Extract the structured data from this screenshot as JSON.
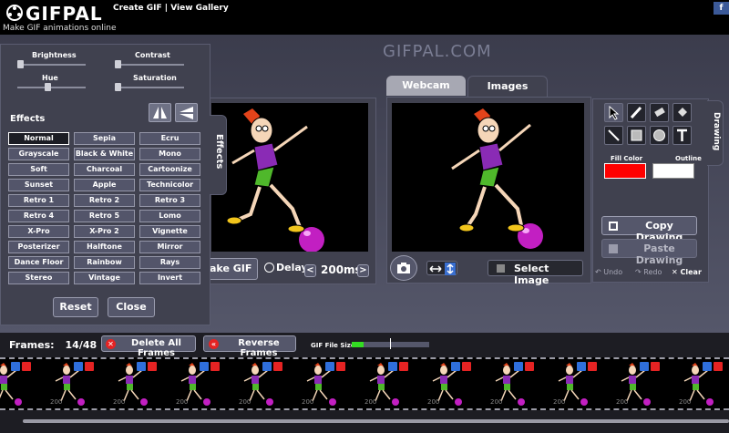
{
  "header": {
    "logo_text": "GIFPAL",
    "tagline": "Make GIF animations online",
    "nav": "Create GIF | View Gallery",
    "fb": "f"
  },
  "watermark": "GIFPAL.COM",
  "effects_panel": {
    "sliders": [
      {
        "label": "Brightness",
        "value": 0.0
      },
      {
        "label": "Contrast",
        "value": 0.0
      },
      {
        "label": "Hue",
        "value": 0.0
      },
      {
        "label": "Saturation",
        "value": 0.0
      }
    ],
    "title": "Effects",
    "tab_label": "Effects",
    "selected": "Normal",
    "effects": [
      "Normal",
      "Sepia",
      "Ecru",
      "Grayscale",
      "Black & White",
      "Mono",
      "Soft",
      "Charcoal",
      "Cartoonize",
      "Sunset",
      "Apple",
      "Technicolor",
      "Retro 1",
      "Retro 2",
      "Retro 3",
      "Retro 4",
      "Retro 5",
      "Lomo",
      "X-Pro",
      "X-Pro 2",
      "Vignette",
      "Posterizer",
      "Halftone",
      "Mirror",
      "Dance Floor",
      "Rainbow",
      "Rays",
      "Stereo",
      "Vintage",
      "Invert"
    ],
    "reset_label": "Reset",
    "close_label": "Close"
  },
  "left_frame": {
    "make_label": "ake GIF",
    "delay_label": "Delay:",
    "delay_value": "200ms",
    "prev": "<",
    "next": ">"
  },
  "right_frame": {
    "tabs": [
      "Webcam",
      "Images"
    ],
    "active_tab": "Images",
    "select_image_label": "Select Image"
  },
  "drawing": {
    "tab_label": "Drawing",
    "fill_label": "Fill Color",
    "outline_label": "Outline",
    "fill_color": "#ff0000",
    "outline_color": "#ffffff",
    "copy_label": "Copy Drawing",
    "paste_label": "Paste Drawing",
    "undo_label": "Undo",
    "redo_label": "Redo",
    "clear_label": "Clear"
  },
  "bottom": {
    "frames_label": "Frames:",
    "frames_count": "14/48",
    "delete_all_label": "Delete All Frames",
    "reverse_label": "Reverse Frames",
    "filesize_label": "GIF File Size:",
    "filesize_fraction": 0.15,
    "thumb_caption": "200"
  },
  "colors": {
    "accent_red": "#e52323",
    "accent_blue": "#2f6fdc",
    "size_green": "#33dd22"
  }
}
